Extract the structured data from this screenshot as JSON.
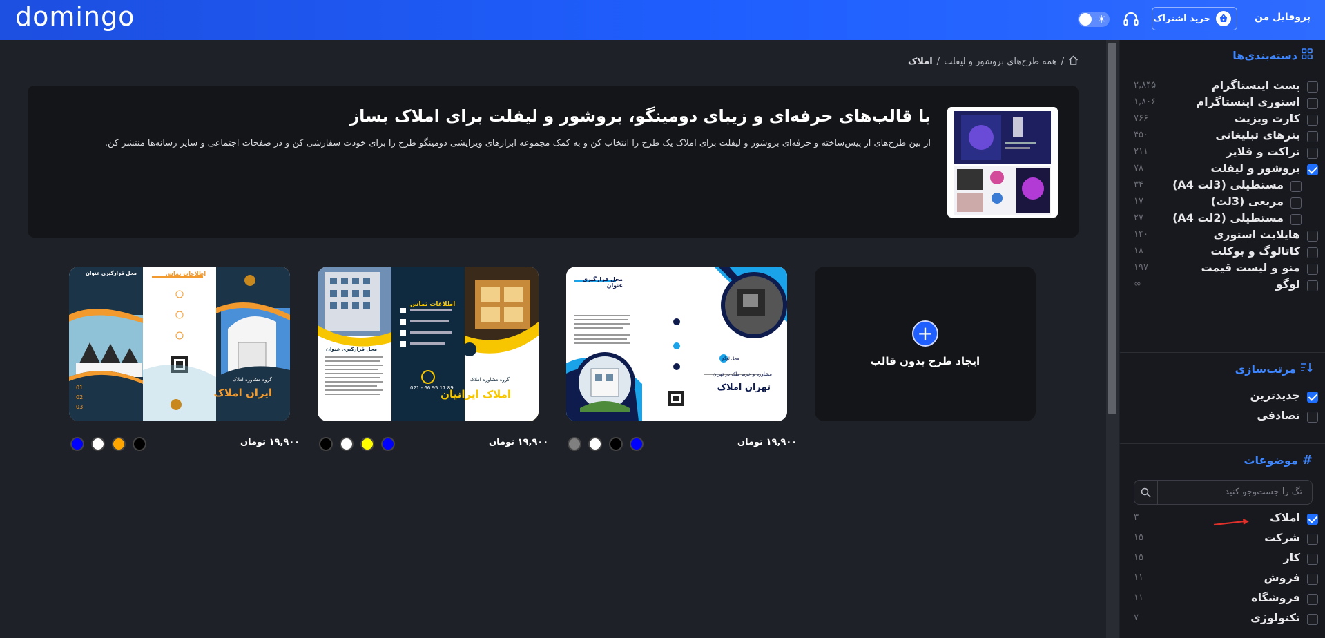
{
  "header": {
    "logo": "domingo",
    "profile_label": "پروفایل من",
    "subscribe_label": "خرید اشتراک"
  },
  "breadcrumb": {
    "home_icon": "home-icon",
    "items": [
      "همه طرح‌های بروشور و لیفلت",
      "املاک"
    ]
  },
  "hero": {
    "title": "با قالب‌های حرفه‌ای و زیبای دومینگو، بروشور و لیفلت برای املاک بساز",
    "description": "از بین طرح‌های از پیش‌ساخته و حرفه‌ای بروشور و لیفلت برای املاک یک طرح را انتخاب کن و به کمک مجموعه ابزارهای ویرایشی دومینگو طرح را برای خودت سفارشی کن و در صفحات اجتماعی و سایر رسانه‌ها منتشر کن."
  },
  "create_card": {
    "label": "ایجاد طرح بدون قالب"
  },
  "templates": [
    {
      "price": "۱۹,۹۰۰ تومان",
      "colors": [
        "#0000ff",
        "#000000",
        "#ffffff",
        "#808080"
      ],
      "texts": {
        "title": "تهران املاک",
        "sub": "مشاوره و خرید ملک در تهران",
        "place": "محل قرارگیری عنوان",
        "logo": "محل لوگو"
      }
    },
    {
      "price": "۱۹,۹۰۰ تومان",
      "colors": [
        "#0000ff",
        "#ffff00",
        "#ffffff",
        "#000000"
      ],
      "texts": {
        "title": "املاک ایرانیان",
        "sub": "گروه مشاوره املاک",
        "contact": "اطلاعات تماس",
        "phone": "021 - 66 95 17 89",
        "place": "محل قرارگیری عنوان"
      }
    },
    {
      "price": "۱۹,۹۰۰ تومان",
      "colors": [
        "#000000",
        "#ffa500",
        "#ffffff",
        "#0000ff"
      ],
      "texts": {
        "title": "ایران املاک",
        "sub": "گروه مشاوره املاک",
        "contact": "اطلاعات تماس",
        "place": "محل قرارگیری عنوان"
      }
    }
  ],
  "sidebar": {
    "categories_title": "دسته‌بندی‌ها",
    "categories": [
      {
        "label": "پست اینستاگرام",
        "count": "۲,۸۴۵",
        "checked": false
      },
      {
        "label": "استوری اینستاگرام",
        "count": "۱,۸۰۶",
        "checked": false
      },
      {
        "label": "کارت ویزیت",
        "count": "۷۶۶",
        "checked": false
      },
      {
        "label": "بنرهای تبلیغاتی",
        "count": "۴۵۰",
        "checked": false
      },
      {
        "label": "تراکت و فلایر",
        "count": "۲۱۱",
        "checked": false
      },
      {
        "label": "بروشور و لیفلت",
        "count": "۷۸",
        "checked": true
      },
      {
        "label": "مستطیلی (3لت A4)",
        "count": "۳۴",
        "checked": false,
        "sub": true
      },
      {
        "label": "مربعی (3لت)",
        "count": "۱۷",
        "checked": false,
        "sub": true
      },
      {
        "label": "مستطیلی (2لت A4)",
        "count": "۲۷",
        "checked": false,
        "sub": true
      },
      {
        "label": "هایلایت استوری",
        "count": "۱۴۰",
        "checked": false
      },
      {
        "label": "کاتالوگ و بوکلت",
        "count": "۱۸",
        "checked": false
      },
      {
        "label": "منو و لیست قیمت",
        "count": "۱۹۷",
        "checked": false
      },
      {
        "label": "لوگو",
        "count": "∞",
        "checked": false
      }
    ],
    "sort_title": "مرتب‌سازی",
    "sort_options": [
      {
        "label": "جدیدترین",
        "checked": true
      },
      {
        "label": "تصادفی",
        "checked": false
      }
    ],
    "topics_title": "موضوعات",
    "topics_search_placeholder": "تگ را جست‌وجو کنید",
    "topics": [
      {
        "label": "املاک",
        "count": "۳",
        "checked": true
      },
      {
        "label": "شرکت",
        "count": "۱۵",
        "checked": false
      },
      {
        "label": "کار",
        "count": "۱۵",
        "checked": false
      },
      {
        "label": "فروش",
        "count": "۱۱",
        "checked": false
      },
      {
        "label": "فروشگاه",
        "count": "۱۱",
        "checked": false
      },
      {
        "label": "تکنولوژی",
        "count": "۷",
        "checked": false
      }
    ]
  },
  "colors": {
    "accent": "#1f5fff",
    "header": "#1f5fff",
    "bg": "#1f2128"
  }
}
